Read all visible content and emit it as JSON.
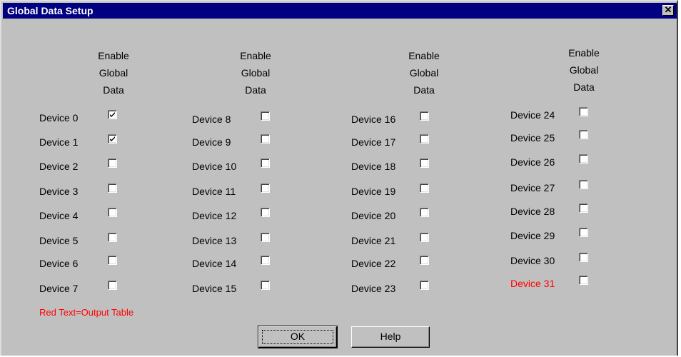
{
  "window": {
    "title": "Global Data Setup",
    "close_glyph": "✕"
  },
  "column_header": [
    "Enable",
    "Global",
    "Data"
  ],
  "devices": [
    {
      "label": "Device 0",
      "checked": true,
      "red": false
    },
    {
      "label": "Device 1",
      "checked": true,
      "red": false
    },
    {
      "label": "Device 2",
      "checked": false,
      "red": false
    },
    {
      "label": "Device 3",
      "checked": false,
      "red": false
    },
    {
      "label": "Device 4",
      "checked": false,
      "red": false
    },
    {
      "label": "Device 5",
      "checked": false,
      "red": false
    },
    {
      "label": "Device 6",
      "checked": false,
      "red": false
    },
    {
      "label": "Device 7",
      "checked": false,
      "red": false
    },
    {
      "label": "Device 8",
      "checked": false,
      "red": false
    },
    {
      "label": "Device 9",
      "checked": false,
      "red": false
    },
    {
      "label": "Device 10",
      "checked": false,
      "red": false
    },
    {
      "label": "Device 11",
      "checked": false,
      "red": false
    },
    {
      "label": "Device 12",
      "checked": false,
      "red": false
    },
    {
      "label": "Device 13",
      "checked": false,
      "red": false
    },
    {
      "label": "Device 14",
      "checked": false,
      "red": false
    },
    {
      "label": "Device 15",
      "checked": false,
      "red": false
    },
    {
      "label": "Device 16",
      "checked": false,
      "red": false
    },
    {
      "label": "Device 17",
      "checked": false,
      "red": false
    },
    {
      "label": "Device 18",
      "checked": false,
      "red": false
    },
    {
      "label": "Device 19",
      "checked": false,
      "red": false
    },
    {
      "label": "Device 20",
      "checked": false,
      "red": false
    },
    {
      "label": "Device 21",
      "checked": false,
      "red": false
    },
    {
      "label": "Device 22",
      "checked": false,
      "red": false
    },
    {
      "label": "Device 23",
      "checked": false,
      "red": false
    },
    {
      "label": "Device 24",
      "checked": false,
      "red": false
    },
    {
      "label": "Device 25",
      "checked": false,
      "red": false
    },
    {
      "label": "Device 26",
      "checked": false,
      "red": false
    },
    {
      "label": "Device 27",
      "checked": false,
      "red": false
    },
    {
      "label": "Device 28",
      "checked": false,
      "red": false
    },
    {
      "label": "Device 29",
      "checked": false,
      "red": false
    },
    {
      "label": "Device 30",
      "checked": false,
      "red": false
    },
    {
      "label": "Device 31",
      "checked": false,
      "red": true
    }
  ],
  "note": "Red Text=Output Table",
  "buttons": {
    "ok": "OK",
    "help": "Help"
  },
  "colors": {
    "titlebar": "#000080",
    "face": "#c0c0c0",
    "output_text": "#ff0000"
  }
}
